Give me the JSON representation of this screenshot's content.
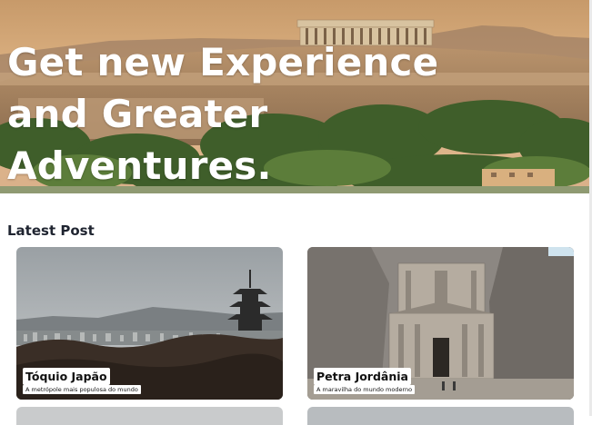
{
  "hero": {
    "title_lines": [
      "Get new Experience",
      "and Greater",
      "Adventures."
    ]
  },
  "latest": {
    "heading": "Latest Post",
    "posts": [
      {
        "title": "Tóquio Japão",
        "subtitle": "A metrópole mais populosa do mundo"
      },
      {
        "title": "Petra Jordânia",
        "subtitle": "A maravilha do mundo moderno"
      }
    ]
  },
  "colors": {
    "hero_text": "#ffffff",
    "heading": "#1f2430",
    "label_bg": "#ffffff"
  }
}
